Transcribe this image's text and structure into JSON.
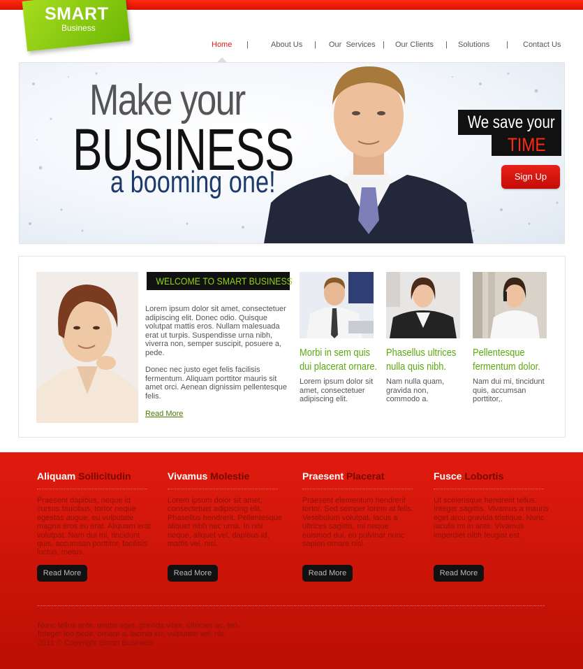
{
  "brand": {
    "logo_main": "SMART",
    "logo_sub": "Business",
    "accent_color": "#e01b0e",
    "green_color": "#7cc40f"
  },
  "nav": {
    "items": [
      {
        "label": "Home",
        "active": true
      },
      {
        "label": "About Us",
        "active": false
      },
      {
        "label": "Our  Services",
        "active": false
      },
      {
        "label": "Our Clients",
        "active": false
      },
      {
        "label": "Solutions",
        "active": false
      },
      {
        "label": "Contact Us",
        "active": false
      }
    ],
    "separator": "|"
  },
  "hero": {
    "line1": "Make your",
    "line2": "BUSINESS",
    "line3": "a booming one!",
    "save_line1": "We save your",
    "save_line2": "TIME",
    "signup_label": "Sign Up"
  },
  "welcome": {
    "heading": "WELCOME TO  SMART BUSINESS",
    "paragraph1": "Lorem ipsum dolor sit amet, consectetuer adipiscing elit. Donec odio. Quisque volutpat mattis eros. Nullam malesuada erat ut turpis. Suspendisse urna nibh, viverra non, semper suscipit, posuere a, pede.",
    "paragraph2": "Donec nec justo eget felis facilisis fermentum. Aliquam porttitor mauris sit amet orci. Aenean dignissim pellentesque felis.",
    "read_more": "Read More"
  },
  "cards": [
    {
      "title": "Morbi in sem quis dui placerat ornare.",
      "text": "Lorem ipsum dolor sit amet, consectetuer adipiscing elit."
    },
    {
      "title": "Phasellus ultrices nulla quis nibh.",
      "text": "Nam nulla quam, gravida non, commodo a."
    },
    {
      "title": "Pellentesque fermentum dolor.",
      "text": "Nam dui mi, tincidunt quis, accumsan porttitor,."
    }
  ],
  "footer": {
    "columns": [
      {
        "title_plain": "Aliquam",
        "title_accent": "Sollicitudin",
        "text": "Praesent dapibus, neque id cursus faucibus, tortor neque egestas augue, eu vulputate magna eros eu erat. Aliquam erat volutpat. Nam dui mi, tincidunt quis, accumsan porttitor, facilisis luctus, metus.",
        "button": "Read More"
      },
      {
        "title_plain": "Vivamus",
        "title_accent": "Molestie",
        "text": "Lorem ipsum dolor sit amet, consectetuer adipiscing elit. Phasellus hendrerit. Pellentesque aliquet nibh nec urna. In nisi neque, aliquet vel, dapibus id, mattis vel, nisi.",
        "button": "Read More"
      },
      {
        "title_plain": "Praesent",
        "title_accent": "Placerat",
        "text": "Praesent elementum hendrerit tortor. Sed semper lorem at felis. Vestibulum volutpat, lacus a ultrices sagittis, mi neque euismod dui, eu pulvinar nunc sapien ornare nisl.",
        "button": "Read More"
      },
      {
        "title_plain": "Fusce",
        "title_accent": "Lobortis",
        "text": "Ut scelerisque hendrerit tellus. Integer sagittis. Vivamus a mauris eget arcu gravida tristique. Nunc iaculis mi in ante. Vivamus imperdiet nibh feugiat est.",
        "button": "Read More"
      }
    ],
    "copyright_line1": "Nunc tellus ante, mattis eget, gravida vitae, ultricies ac, leo.",
    "copyright_line2": "Integer leo pede, ornare a, lacinia eu, vulputate vel, nis.",
    "copyright_line3": "2011 © Copyright Smart Business"
  }
}
